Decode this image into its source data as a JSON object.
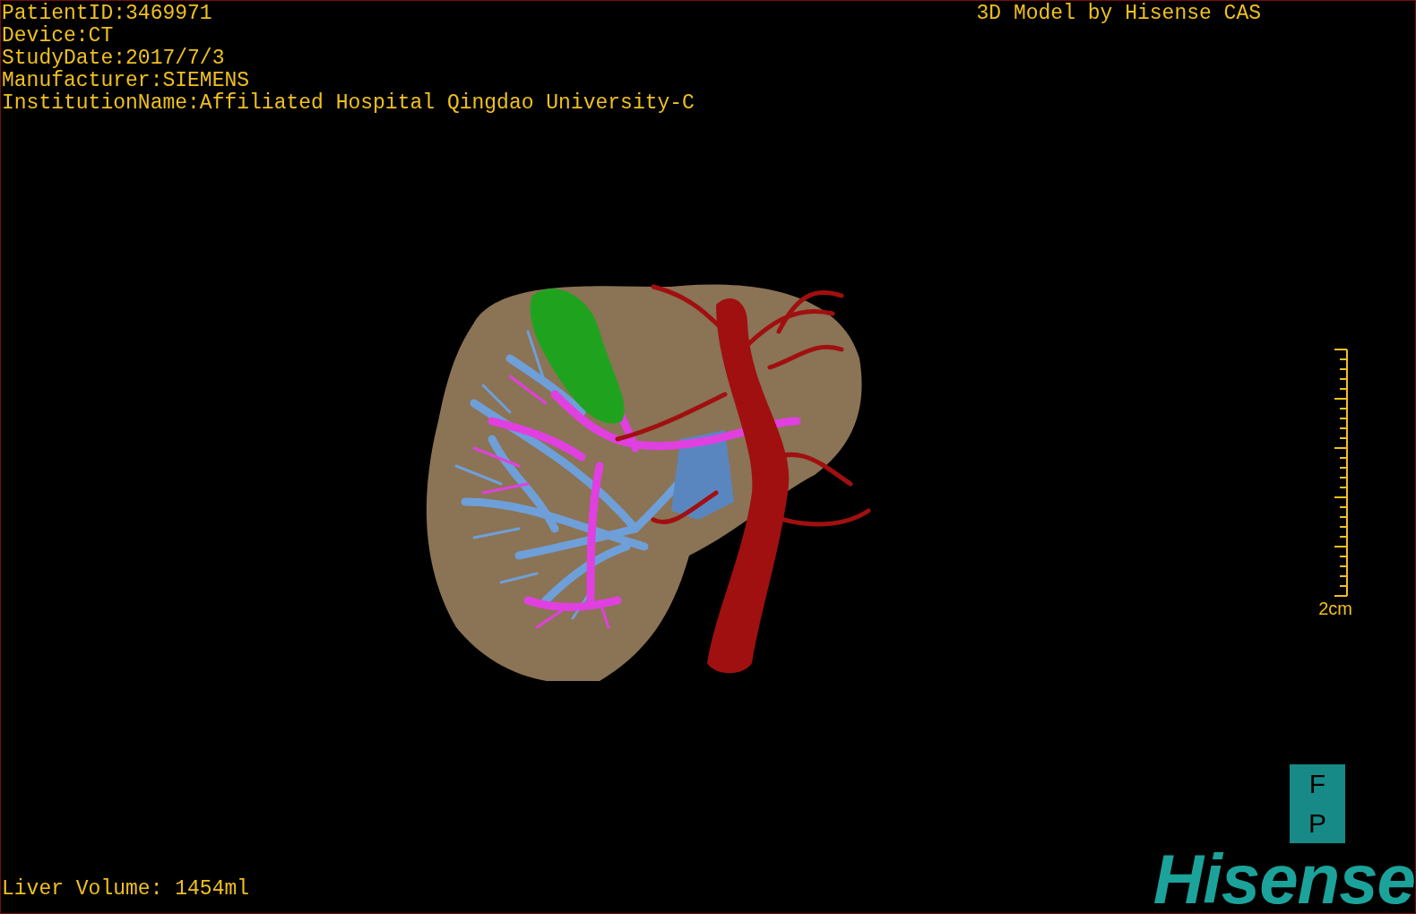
{
  "patient_info": [
    "PatientID:3469971",
    "Device:CT",
    "StudyDate:2017/7/3",
    "Manufacturer:SIEMENS",
    "InstitutionName:Affiliated Hospital Qingdao University-C"
  ],
  "title": "3D Model by Hisense CAS",
  "scale_bar": {
    "label": "2cm"
  },
  "orientation_marker": [
    "F",
    "P"
  ],
  "liver_volume": "Liver Volume: 1454ml",
  "logo": "Hisense"
}
